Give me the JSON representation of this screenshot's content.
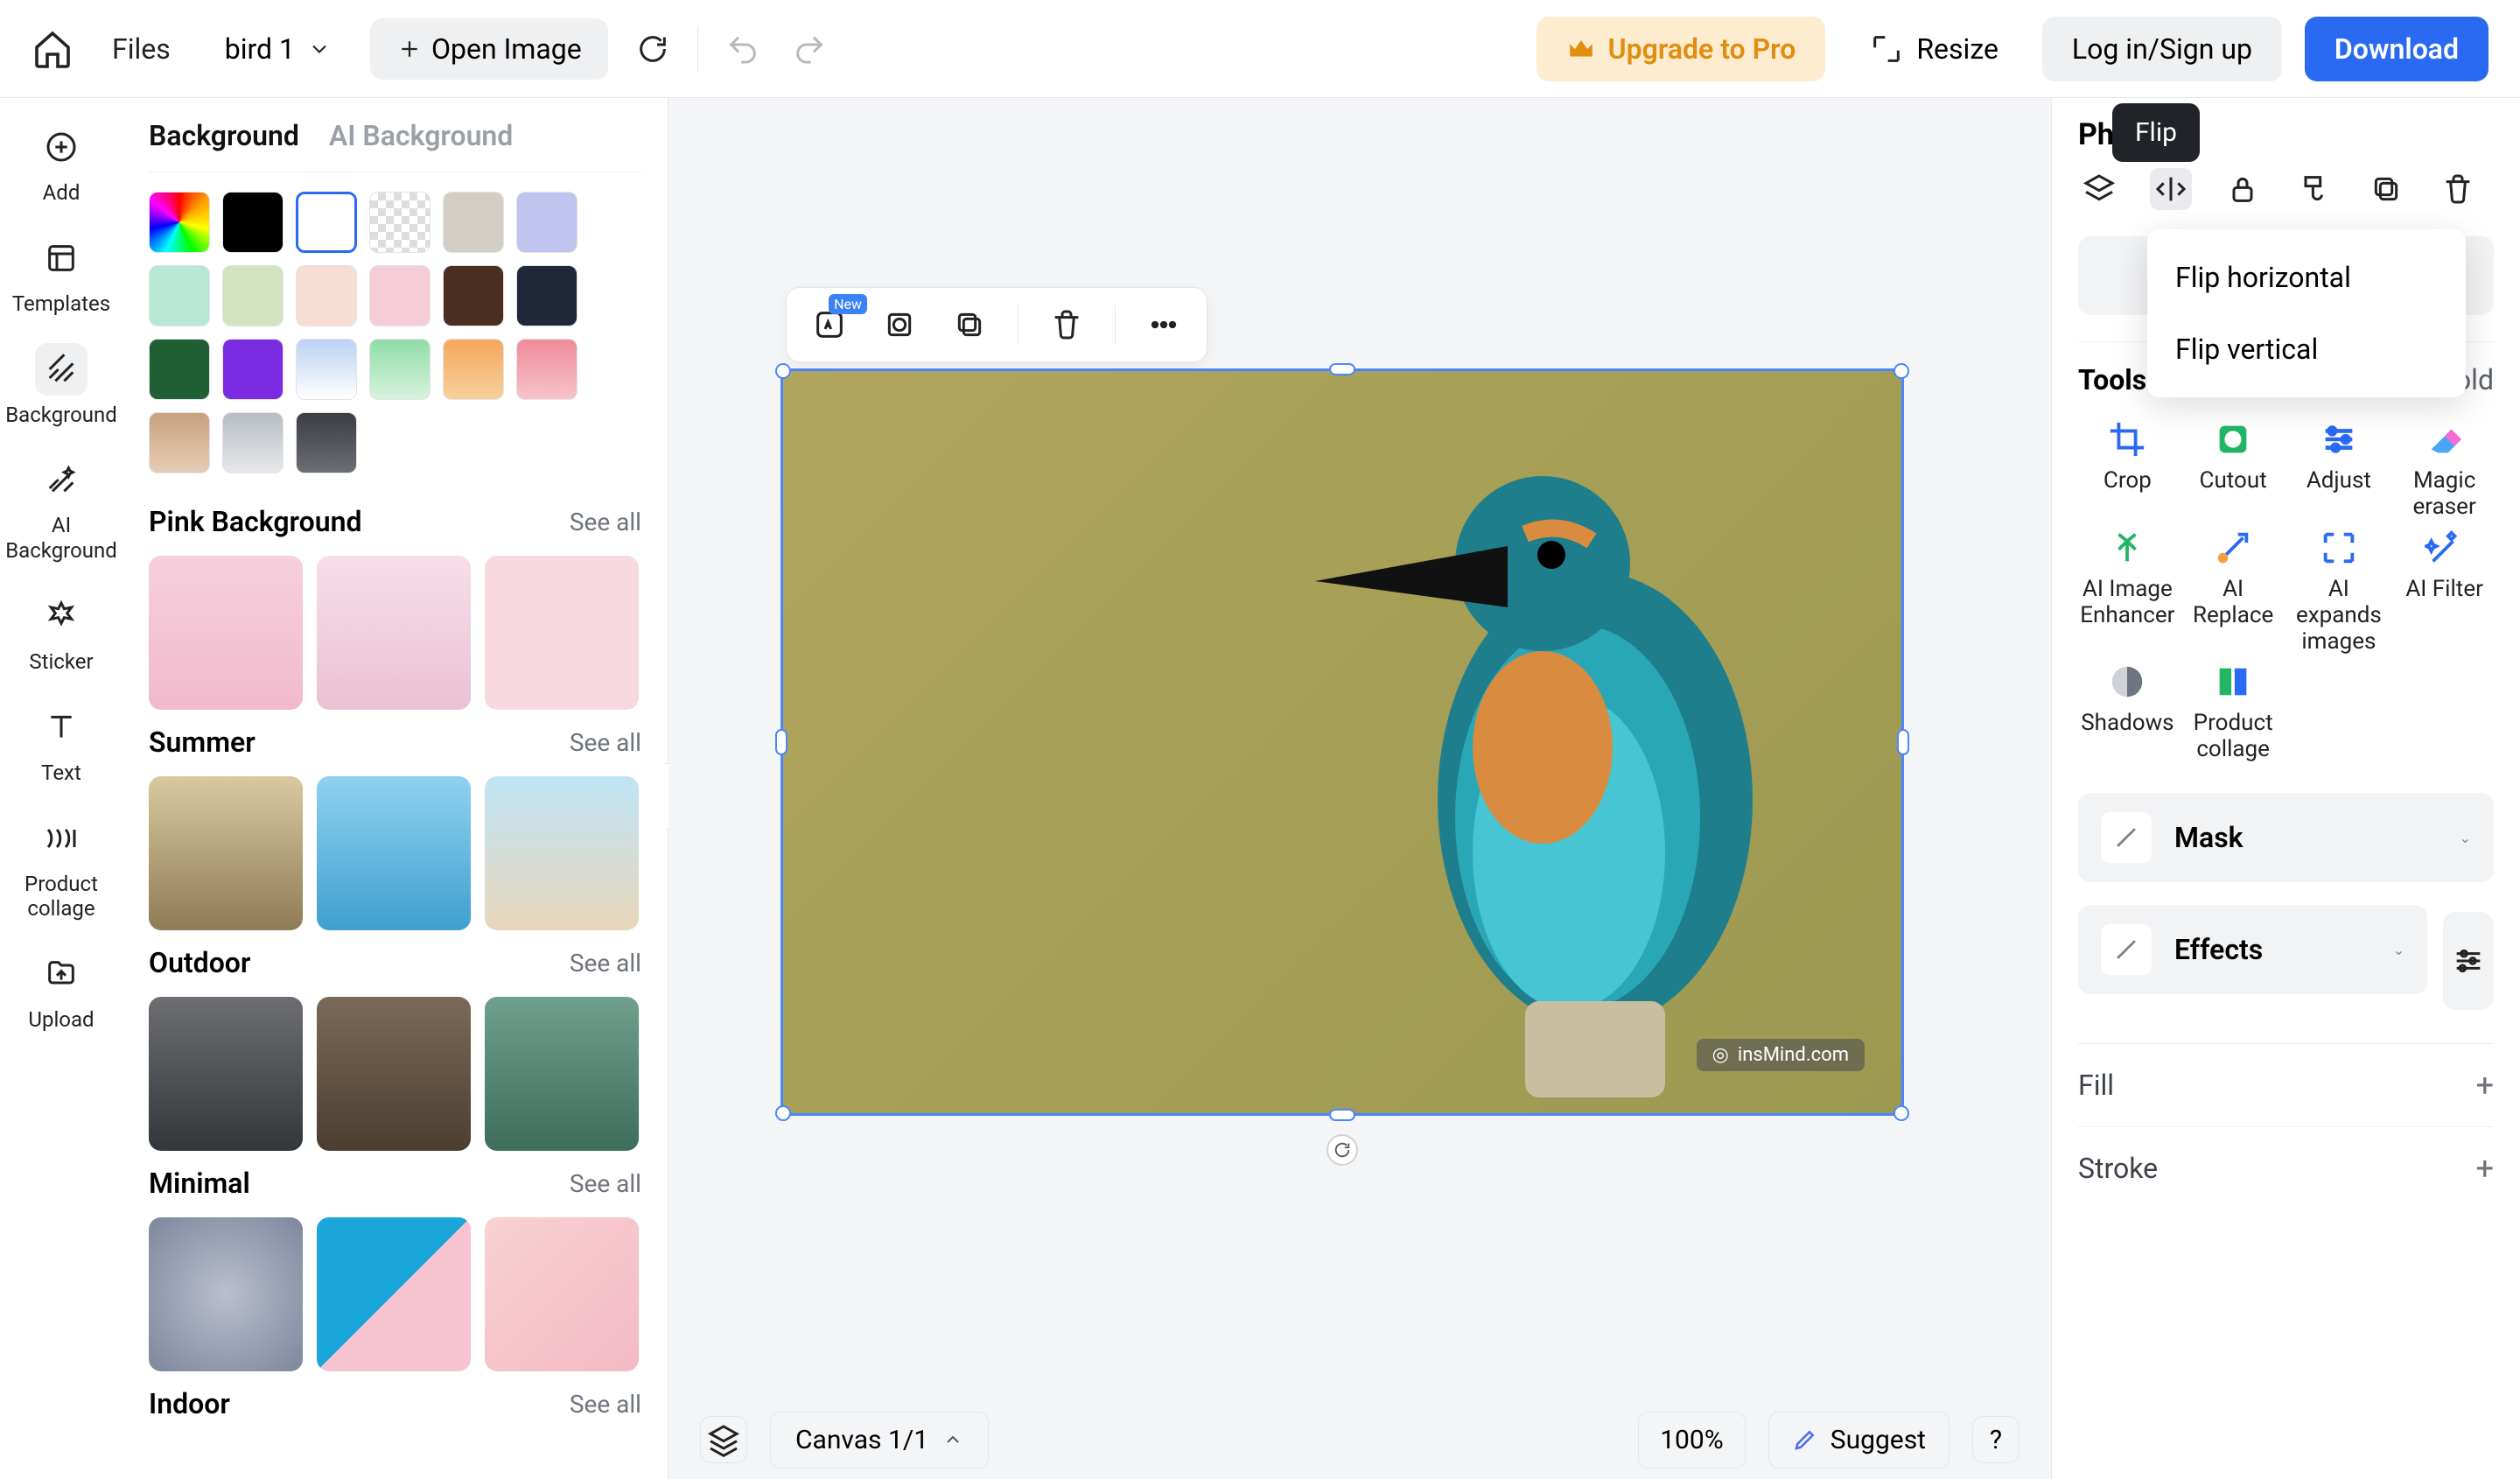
{
  "topbar": {
    "files": "Files",
    "filename": "bird 1",
    "open_image": "Open Image",
    "upgrade": "Upgrade to Pro",
    "resize": "Resize",
    "login": "Log in/Sign up",
    "download": "Download"
  },
  "leftrail": [
    {
      "label": "Add"
    },
    {
      "label": "Templates"
    },
    {
      "label": "Background"
    },
    {
      "label": "AI\nBackground"
    },
    {
      "label": "Sticker"
    },
    {
      "label": "Text"
    },
    {
      "label": "Product\ncollage"
    },
    {
      "label": "Upload"
    }
  ],
  "leftpanel": {
    "tabs": {
      "bg": "Background",
      "ai": "AI Background"
    },
    "swatches": [
      "rainbow",
      "#000000",
      "#ffffff",
      "transparent",
      "#d2cec5",
      "#bfc4ef",
      "#b7e8d3",
      "#d2e3bf",
      "#f7ddd1",
      "#f6cdd6",
      "#4a2e1f",
      "#1e2838",
      "#1f5f33",
      "#7a2be2",
      "#bcd0f2",
      "#8fdca8",
      "#f5a75b",
      "#ef8b99",
      "#c9a17d",
      "#b7bdc4",
      "#3a3d41"
    ],
    "sections": [
      {
        "title": "Pink Background",
        "seeall": "See all"
      },
      {
        "title": "Summer",
        "seeall": "See all"
      },
      {
        "title": "Outdoor",
        "seeall": "See all"
      },
      {
        "title": "Minimal",
        "seeall": "See all"
      },
      {
        "title": "Indoor",
        "seeall": "See all"
      }
    ]
  },
  "canvas": {
    "float_new": "New",
    "watermark": "insMind.com",
    "canvas_chip": "Canvas 1/1",
    "zoom": "100%",
    "suggest": "Suggest",
    "help": "?"
  },
  "rightpanel": {
    "title": "Photo",
    "tools_label": "Tools",
    "fold": "Fold",
    "tools": [
      "Crop",
      "Cutout",
      "Adjust",
      "Magic\neraser",
      "AI Image\nEnhancer",
      "AI\nReplace",
      "AI\nexpands\nimages",
      "AI Filter",
      "Shadows",
      "Product\ncollage"
    ],
    "mask": "Mask",
    "effects": "Effects",
    "fill": "Fill",
    "stroke": "Stroke"
  },
  "tooltip": "Flip",
  "flip_menu": [
    "Flip horizontal",
    "Flip vertical"
  ]
}
